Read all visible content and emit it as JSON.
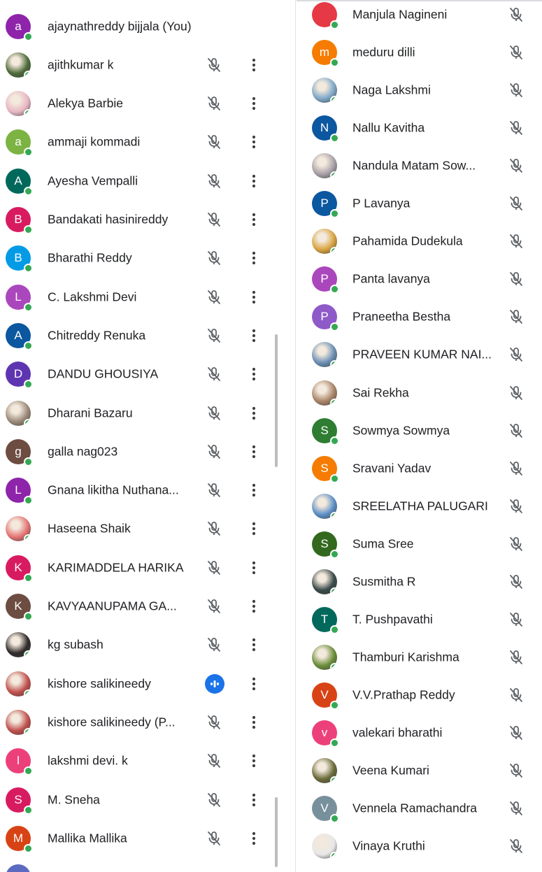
{
  "left_participants": [
    {
      "name": "ajaynathreddy bijjala (You)",
      "initial": "a",
      "color": "#8e24aa",
      "photo": false,
      "mic": "none"
    },
    {
      "name": "ajithkumar k",
      "initial": "",
      "color": "#4e6b3a",
      "photo": true,
      "mic": "muted"
    },
    {
      "name": "Alekya Barbie",
      "initial": "",
      "color": "#e8b7c4",
      "photo": true,
      "mic": "muted"
    },
    {
      "name": "ammaji kommadi",
      "initial": "a",
      "color": "#7cb342",
      "photo": false,
      "mic": "muted"
    },
    {
      "name": "Ayesha Vempalli",
      "initial": "A",
      "color": "#00695c",
      "photo": false,
      "mic": "muted"
    },
    {
      "name": "Bandakati hasinireddy",
      "initial": "B",
      "color": "#d81b60",
      "photo": false,
      "mic": "muted"
    },
    {
      "name": "Bharathi Reddy",
      "initial": "B",
      "color": "#039be5",
      "photo": false,
      "mic": "muted"
    },
    {
      "name": "C. Lakshmi Devi",
      "initial": "L",
      "color": "#ab47bc",
      "photo": false,
      "mic": "muted"
    },
    {
      "name": "Chitreddy Renuka",
      "initial": "A",
      "color": "#0b57a0",
      "photo": false,
      "mic": "muted"
    },
    {
      "name": "DANDU GHOUSIYA",
      "initial": "D",
      "color": "#5e35b1",
      "photo": false,
      "mic": "muted"
    },
    {
      "name": "Dharani Bazaru",
      "initial": "",
      "color": "#9c8a7a",
      "photo": true,
      "mic": "muted"
    },
    {
      "name": "galla nag023",
      "initial": "g",
      "color": "#6d4c41",
      "photo": false,
      "mic": "muted"
    },
    {
      "name": "Gnana likitha Nuthana...",
      "initial": "L",
      "color": "#8e24aa",
      "photo": false,
      "mic": "muted"
    },
    {
      "name": "Haseena Shaik",
      "initial": "",
      "color": "#e57373",
      "photo": true,
      "mic": "muted"
    },
    {
      "name": "KARIMADDELA HARIKA",
      "initial": "K",
      "color": "#d81b60",
      "photo": false,
      "mic": "muted"
    },
    {
      "name": "KAVYAANUPAMA GA...",
      "initial": "K",
      "color": "#6d4c41",
      "photo": false,
      "mic": "muted"
    },
    {
      "name": "kg subash",
      "initial": "",
      "color": "#2f2b2a",
      "photo": true,
      "mic": "muted"
    },
    {
      "name": "kishore salikineedy",
      "initial": "",
      "color": "#c0504d",
      "photo": true,
      "mic": "speaking"
    },
    {
      "name": "kishore salikineedy (P...",
      "initial": "",
      "color": "#c0504d",
      "photo": true,
      "mic": "muted"
    },
    {
      "name": "lakshmi devi. k",
      "initial": "l",
      "color": "#ec407a",
      "photo": false,
      "mic": "muted"
    },
    {
      "name": "M. Sneha",
      "initial": "S",
      "color": "#d81b60",
      "photo": false,
      "mic": "muted"
    },
    {
      "name": "Mallika Mallika",
      "initial": "M",
      "color": "#d84315",
      "photo": false,
      "mic": "muted"
    }
  ],
  "right_participants": [
    {
      "name": "Manjula Nagineni",
      "initial": "",
      "color": "#e53945",
      "photo": false,
      "mic": "muted"
    },
    {
      "name": "meduru dilli",
      "initial": "m",
      "color": "#f57c00",
      "photo": false,
      "mic": "muted"
    },
    {
      "name": "Naga Lakshmi",
      "initial": "",
      "color": "#7fa8c9",
      "photo": true,
      "mic": "muted"
    },
    {
      "name": "Nallu Kavitha",
      "initial": "N",
      "color": "#0b57a0",
      "photo": false,
      "mic": "muted"
    },
    {
      "name": "Nandula Matam Sow...",
      "initial": "",
      "color": "#a8a0a8",
      "photo": true,
      "mic": "muted"
    },
    {
      "name": "P Lavanya",
      "initial": "P",
      "color": "#0b57a0",
      "photo": false,
      "mic": "muted"
    },
    {
      "name": "Pahamida Dudekula",
      "initial": "",
      "color": "#d9a441",
      "photo": true,
      "mic": "muted"
    },
    {
      "name": "Panta lavanya",
      "initial": "P",
      "color": "#ab47bc",
      "photo": false,
      "mic": "muted"
    },
    {
      "name": "Praneetha Bestha",
      "initial": "P",
      "color": "#8e5ac8",
      "photo": false,
      "mic": "muted"
    },
    {
      "name": "PRAVEEN KUMAR NAI...",
      "initial": "",
      "color": "#6a8fb5",
      "photo": true,
      "mic": "muted"
    },
    {
      "name": "Sai Rekha",
      "initial": "",
      "color": "#a98468",
      "photo": true,
      "mic": "muted"
    },
    {
      "name": "Sowmya Sowmya",
      "initial": "S",
      "color": "#2e7d32",
      "photo": false,
      "mic": "muted"
    },
    {
      "name": "Sravani Yadav",
      "initial": "S",
      "color": "#f57c00",
      "photo": false,
      "mic": "muted"
    },
    {
      "name": "SREELATHA PALUGARI",
      "initial": "",
      "color": "#5b8fc7",
      "photo": true,
      "mic": "muted"
    },
    {
      "name": "Suma Sree",
      "initial": "S",
      "color": "#33691e",
      "photo": false,
      "mic": "muted"
    },
    {
      "name": "Susmitha R",
      "initial": "",
      "color": "#3a4a4a",
      "photo": true,
      "mic": "muted"
    },
    {
      "name": "T. Pushpavathi",
      "initial": "T",
      "color": "#00695c",
      "photo": false,
      "mic": "muted"
    },
    {
      "name": "Thamburi Karishma",
      "initial": "",
      "color": "#6b8e3a",
      "photo": true,
      "mic": "muted"
    },
    {
      "name": "V.V.Prathap Reddy",
      "initial": "V",
      "color": "#d84315",
      "photo": false,
      "mic": "muted"
    },
    {
      "name": "valekari bharathi",
      "initial": "v",
      "color": "#ec407a",
      "photo": false,
      "mic": "muted"
    },
    {
      "name": "Veena Kumari",
      "initial": "",
      "color": "#6b6b3a",
      "photo": true,
      "mic": "muted"
    },
    {
      "name": "Vennela Ramachandra",
      "initial": "V",
      "color": "#78909c",
      "photo": false,
      "mic": "muted"
    },
    {
      "name": "Vinaya Kruthi",
      "initial": "",
      "color": "#e8e8e8",
      "photo": true,
      "mic": "muted"
    }
  ],
  "icons": {
    "muted_mic": "mic-off-icon",
    "speaking": "audio-bars-icon",
    "more": "more-vert-icon"
  },
  "colors": {
    "online_dot": "#34a853",
    "speaking_badge": "#1a73e8",
    "muted_icon": "#5f6368"
  }
}
